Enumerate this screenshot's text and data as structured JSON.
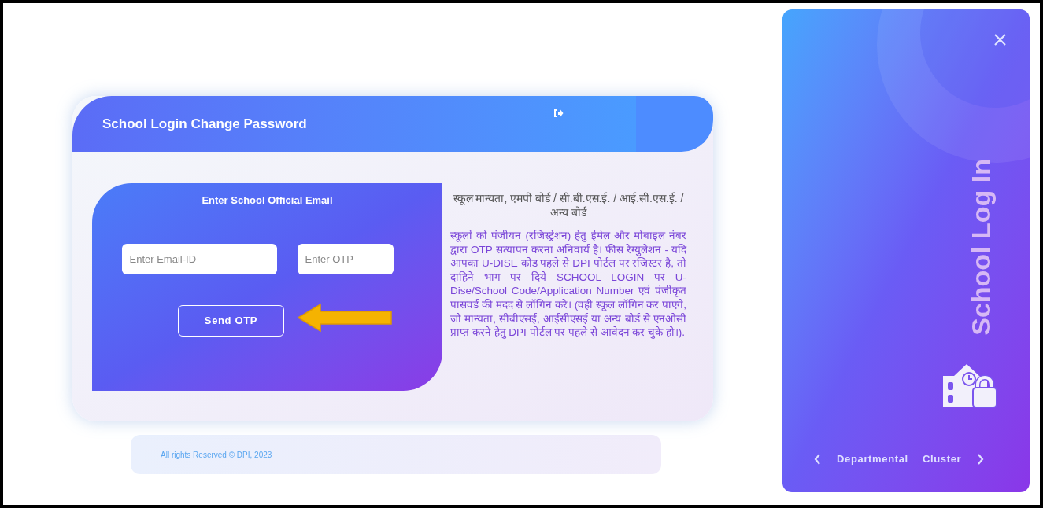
{
  "form": {
    "title": "School Login Change Password",
    "email_card": {
      "heading": "Enter School Official Email",
      "email_placeholder": "Enter Email-ID",
      "otp_placeholder": "Enter OTP",
      "send_button": "Send OTP"
    },
    "info": {
      "heading": "स्कूल मान्यता, एमपी बोर्ड / सी.बी.एस.ई. / आई.सी.एस.ई. / अन्य बोर्ड",
      "body": "स्कूलों को पंजीयन (रजिस्ट्रेशन) हेतु ईमेल और मोबाइल नंबर द्वारा OTP सत्यापन करना अनिवार्य है। फीस रेग्युलेशन - यदि आपका U-DISE कोड पहले से DPI पोर्टल पर रजिस्टर है, तो दाहिने भाग पर दिये SCHOOL LOGIN पर U-Dise/School Code/Application Number एवं पंजीकृत पासवर्ड की मदद से लॉगिन करे। (वही स्कूल लॉगिन कर पाएगे, जो मान्यता, सीबीएसई, आईसीएसई या अन्य बोर्ड से एनओसी प्राप्त करने हेतु DPI पोर्टल पर पहले से आवेदन कर चुके हो।)."
    }
  },
  "footer": "All rights Reserved © DPI, 2023",
  "side_panel": {
    "title": "School Log In",
    "tabs": [
      {
        "label": "Departmental"
      },
      {
        "label": "Cluster"
      }
    ]
  }
}
